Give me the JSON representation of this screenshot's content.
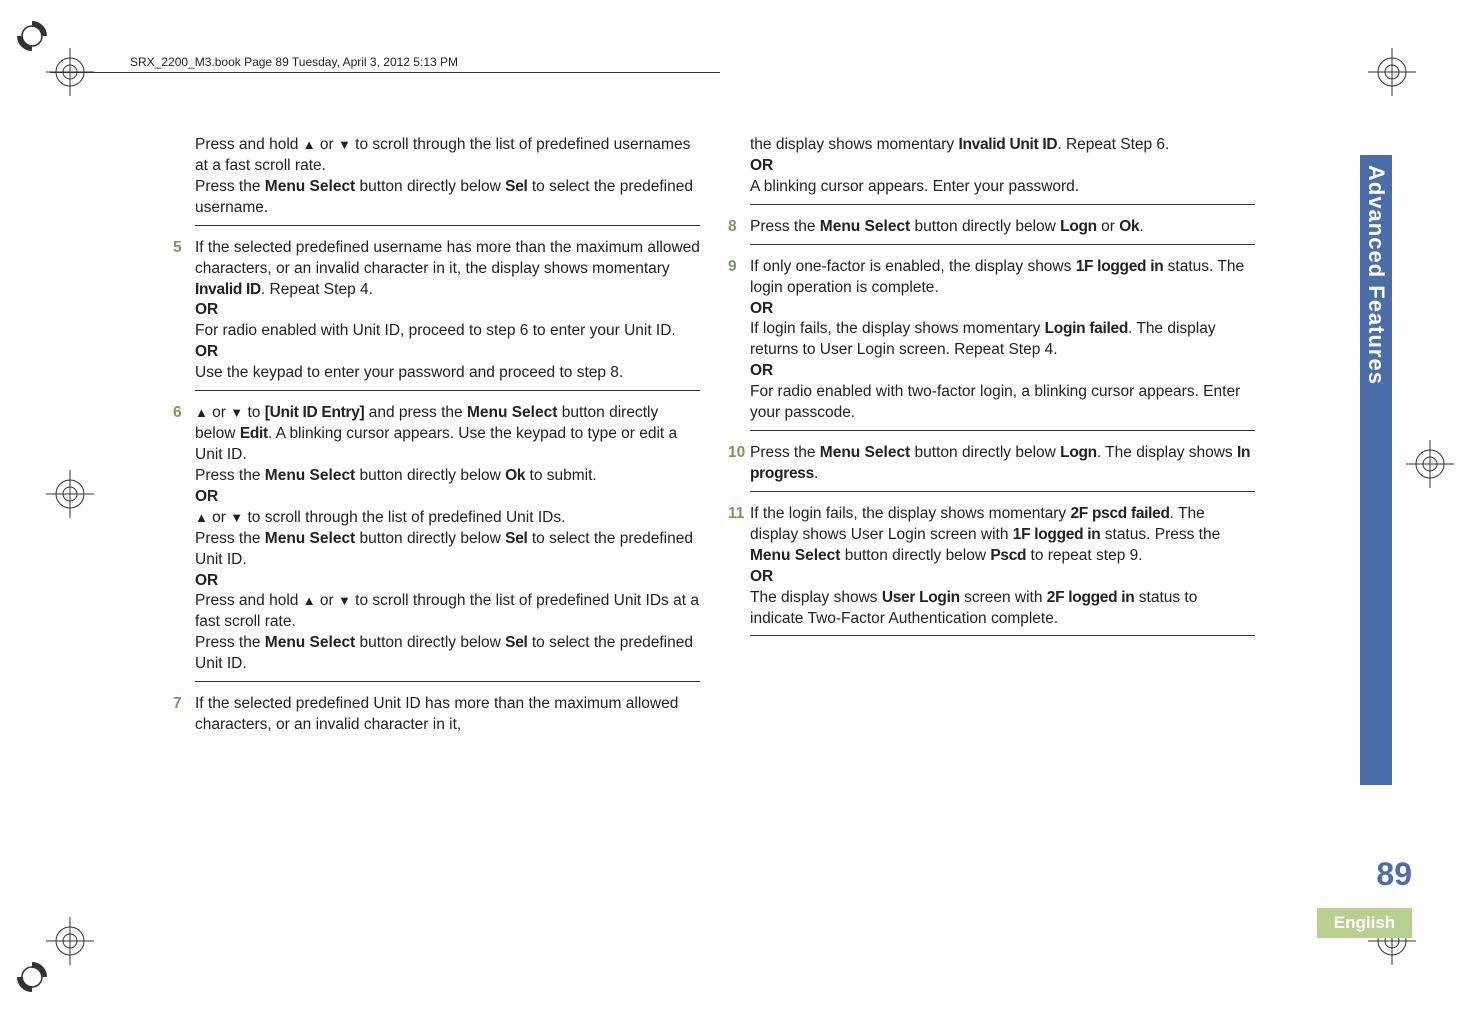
{
  "header": "SRX_2200_M3.book  Page 89  Tuesday, April 3, 2012  5:13 PM",
  "sidebar": "Advanced Features",
  "page_number": "89",
  "language": "English",
  "glyphs": {
    "up": "▲",
    "down": "▼"
  },
  "left": {
    "p1a": "Press and hold ",
    "p1b": " or ",
    "p1c": " to scroll through the list of predefined usernames at a fast scroll rate.",
    "p2a": "Press the ",
    "p2_menu": "Menu Select",
    "p2b": " button directly below ",
    "p2_sel": "Sel",
    "p2c": " to select the predefined username.",
    "s5": {
      "num": "5",
      "a": "If the selected predefined username has more than the maximum allowed characters, or an invalid character in it, the display shows momentary ",
      "inv": "Invalid ID",
      "b": ". Repeat Step 4.",
      "or1": "OR",
      "c": "For radio enabled with Unit ID, proceed to step 6 to enter your Unit ID.",
      "or2": "OR",
      "d": "Use the keypad to enter your password and proceed to step 8."
    },
    "s6": {
      "num": "6",
      "a": " or ",
      "b": " to ",
      "unit": "[Unit ID Entry]",
      "c": " and press the ",
      "menu": "Menu Select",
      "d": " button directly below ",
      "edit": "Edit",
      "e": ". A blinking cursor appears. Use the keypad to type or edit a Unit ID.",
      "f": "Press the ",
      "menu2": "Menu Select",
      "g": " button directly below ",
      "ok": "Ok",
      "h": " to submit.",
      "or1": "OR",
      "i": " or ",
      "j": " to scroll through the list of predefined Unit IDs.",
      "k": "Press the ",
      "menu3": "Menu Select",
      "l": " button directly below ",
      "sel": "Sel",
      "m": " to select the predefined Unit ID.",
      "or2": "OR",
      "n": "Press and hold ",
      "o": " or ",
      "p": " to scroll through the list of predefined Unit IDs at a fast scroll rate.",
      "q": "Press the ",
      "menu4": "Menu Select",
      "r": " button directly below ",
      "sel2": "Sel",
      "s": " to select the predefined Unit ID."
    },
    "s7": {
      "num": "7",
      "a": "If the selected predefined Unit ID has more than the maximum allowed characters, or an invalid character in it,"
    }
  },
  "right": {
    "p1a": "the display shows momentary ",
    "inv": "Invalid Unit ID",
    "p1b": ". Repeat Step 6.",
    "or": "OR",
    "p2": "A blinking cursor appears. Enter your password.",
    "s8": {
      "num": "8",
      "a": "Press the ",
      "menu": "Menu Select",
      "b": " button directly below ",
      "logn": "Logn",
      "c": " or ",
      "ok": "Ok",
      "d": "."
    },
    "s9": {
      "num": "9",
      "a": "If only one-factor is enabled, the display shows ",
      "lf1": "1F logged in",
      "b": " status. The login operation is complete.",
      "or1": "OR",
      "c": "If login fails, the display shows momentary ",
      "lf": "Login failed",
      "d": ". The display returns to User Login screen. Repeat Step 4.",
      "or2": "OR",
      "e": "For radio enabled with two-factor login, a blinking cursor appears. Enter your passcode."
    },
    "s10": {
      "num": "10",
      "a": "Press the ",
      "menu": "Menu Select",
      "b": " button directly below ",
      "logn": "Logn",
      "c": ". The display shows ",
      "ip": "In progress",
      "d": "."
    },
    "s11": {
      "num": "11",
      "a": "If the login fails, the display shows momentary ",
      "pf": "2F pscd failed",
      "b": ". The display shows User Login screen with ",
      "li1": "1F logged in",
      "c": " status. Press the ",
      "menu": "Menu Select",
      "d": " button directly below ",
      "pscd": "Pscd",
      "e": " to repeat step 9.",
      "or": "OR",
      "f": "The display shows ",
      "ul": "User Login",
      "g": " screen with  ",
      "li2": "2F logged in",
      "h": " status to indicate Two-Factor Authentication complete."
    }
  }
}
